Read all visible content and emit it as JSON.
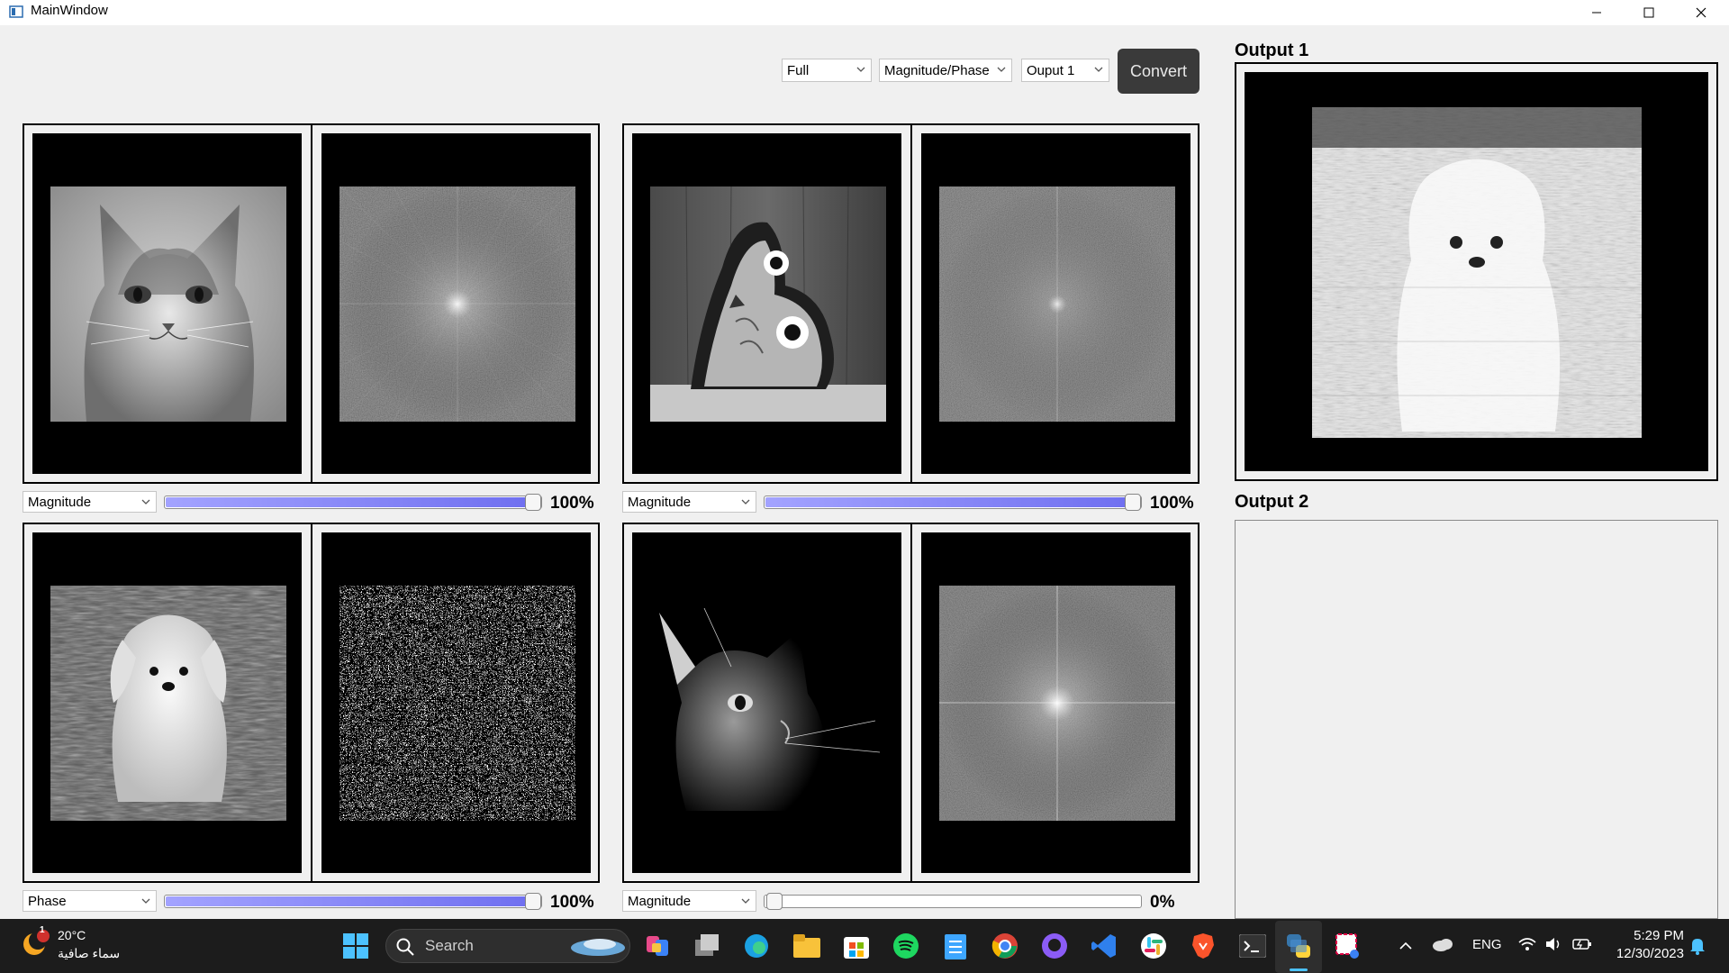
{
  "window": {
    "title": "MainWindow"
  },
  "toolbar": {
    "mode_combo": "Full",
    "mix_combo": "Magnitude/Phase",
    "output_combo": "Ouput 1",
    "convert_label": "Convert"
  },
  "panels": [
    {
      "component": "Magnitude",
      "weight": "100%",
      "weight_value": 1.0
    },
    {
      "component": "Magnitude",
      "weight": "100%",
      "weight_value": 1.0
    },
    {
      "component": "Phase",
      "weight": "100%",
      "weight_value": 1.0
    },
    {
      "component": "Magnitude",
      "weight": "0%",
      "weight_value": 0.0
    }
  ],
  "outputs": {
    "output1_title": "Output 1",
    "output2_title": "Output 2"
  },
  "taskbar": {
    "weather_temp": "20°C",
    "weather_desc": "سماء صافية",
    "weather_badge": "1",
    "search_placeholder": "Search",
    "lang": "ENG",
    "time": "5:29 PM",
    "date": "12/30/2023",
    "icons": [
      "windows-start-icon",
      "copilot-icon",
      "task-view-icon",
      "edge-icon",
      "file-explorer-icon",
      "microsoft-store-icon",
      "spotify-icon",
      "notepad-icon",
      "chrome-icon",
      "github-desktop-icon",
      "vscode-icon",
      "slack-icon",
      "brave-icon",
      "terminal-icon",
      "python-icon",
      "snipping-tool-icon"
    ]
  },
  "colors": {
    "slider_fill": "#7b7bf5",
    "convert_bg": "#3a3a3a",
    "taskbar_bg": "#1c1c1c"
  }
}
